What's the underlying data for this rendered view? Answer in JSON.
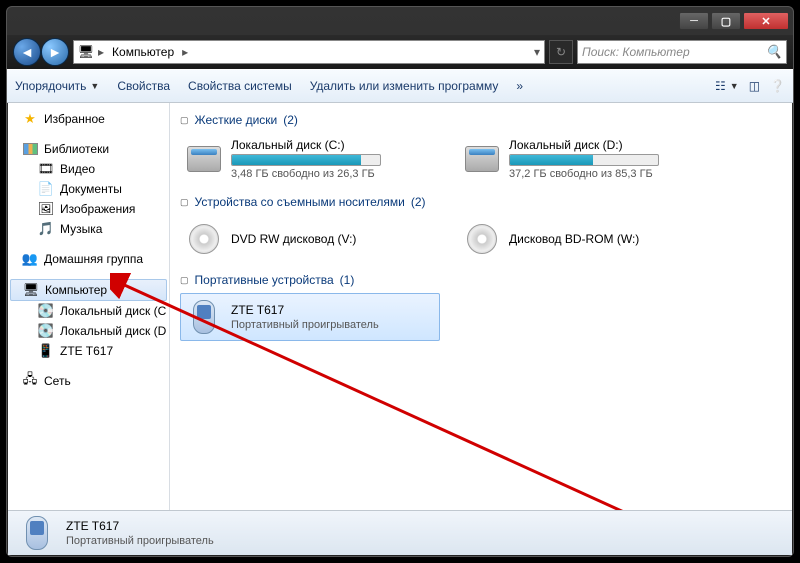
{
  "breadcrumb": {
    "root_icon_alt": "computer",
    "item1": "Компьютер",
    "refresh_alt": "refresh"
  },
  "search": {
    "placeholder": "Поиск: Компьютер"
  },
  "toolbar": {
    "organize": "Упорядочить",
    "properties": "Свойства",
    "sys_properties": "Свойства системы",
    "uninstall": "Удалить или изменить программу",
    "more": "»"
  },
  "sidebar": {
    "favorites": "Избранное",
    "libraries": "Библиотеки",
    "lib_items": {
      "video": "Видео",
      "documents": "Документы",
      "pictures": "Изображения",
      "music": "Музыка"
    },
    "homegroup": "Домашняя группа",
    "computer": "Компьютер",
    "comp_items": {
      "c": "Локальный диск (C",
      "d": "Локальный диск (D",
      "zte": "ZTE T617"
    },
    "network": "Сеть"
  },
  "sections": {
    "hdd": {
      "title": "Жесткие диски",
      "count": "(2)"
    },
    "removable": {
      "title": "Устройства со съемными носителями",
      "count": "(2)"
    },
    "portable": {
      "title": "Портативные устройства",
      "count": "(1)"
    }
  },
  "drives": {
    "c": {
      "name": "Локальный диск (C:)",
      "free": "3,48 ГБ свободно из 26,3 ГБ",
      "fill_pct": 87
    },
    "d": {
      "name": "Локальный диск (D:)",
      "free": "37,2 ГБ свободно из 85,3 ГБ",
      "fill_pct": 56
    },
    "v": {
      "name": "DVD RW дисковод (V:)"
    },
    "w": {
      "name": "Дисковод BD-ROM (W:)"
    },
    "zte": {
      "name": "ZTE T617",
      "sub": "Портативный проигрыватель"
    }
  },
  "status": {
    "name": "ZTE T617",
    "sub": "Портативный проигрыватель"
  }
}
